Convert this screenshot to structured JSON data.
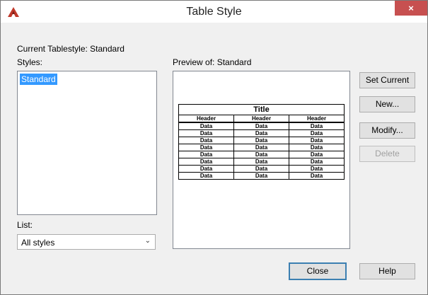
{
  "window": {
    "title": "Table Style",
    "close_label": "×"
  },
  "current_tablestyle": "Current Tablestyle: Standard",
  "styles": {
    "label": "Styles:",
    "items": [
      "Standard"
    ]
  },
  "list": {
    "label": "List:",
    "selected": "All styles"
  },
  "preview": {
    "label": "Preview of: Standard",
    "table_title": "Title",
    "headers": [
      "Header",
      "Header",
      "Header"
    ],
    "rows": [
      [
        "Data",
        "Data",
        "Data"
      ],
      [
        "Data",
        "Data",
        "Data"
      ],
      [
        "Data",
        "Data",
        "Data"
      ],
      [
        "Data",
        "Data",
        "Data"
      ],
      [
        "Data",
        "Data",
        "Data"
      ],
      [
        "Data",
        "Data",
        "Data"
      ],
      [
        "Data",
        "Data",
        "Data"
      ],
      [
        "Data",
        "Data",
        "Data"
      ]
    ]
  },
  "buttons": {
    "set_current": "Set Current",
    "new": "New...",
    "modify": "Modify...",
    "delete": "Delete",
    "close": "Close",
    "help": "Help"
  },
  "colors": {
    "selection": "#3399ff",
    "close_button": "#c75050",
    "app_icon": "#c0392b"
  }
}
